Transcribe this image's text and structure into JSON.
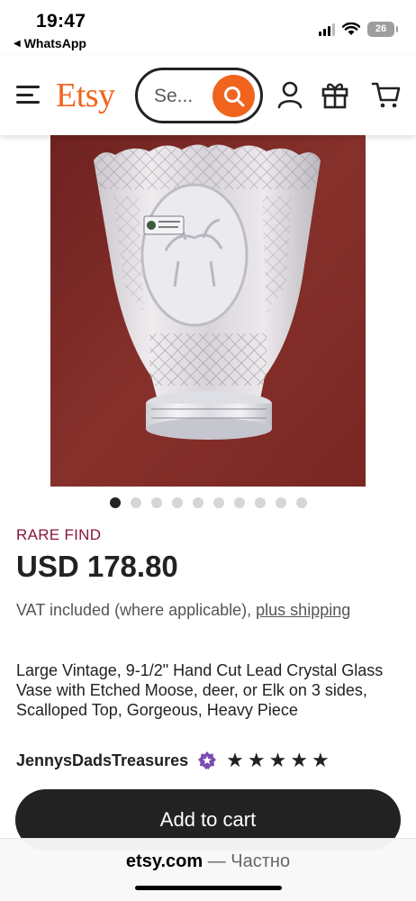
{
  "status_bar": {
    "time": "19:47",
    "back_app": "WhatsApp",
    "battery": "26"
  },
  "header": {
    "logo": "Etsy",
    "search_placeholder": "Se...",
    "icons": [
      "menu-icon",
      "search-icon",
      "account-icon",
      "gift-icon",
      "cart-icon"
    ],
    "accent_color": "#f1641e"
  },
  "gallery": {
    "image_count": 10,
    "active_index": 0,
    "background_color": "#7a2724"
  },
  "product": {
    "badge": "RARE FIND",
    "price": "USD 178.80",
    "vat_text": "VAT included (where applicable), ",
    "shipping_link": "plus shipping",
    "title": "Large Vintage, 9-1/2\" Hand Cut Lead Crystal Glass Vase with Etched Moose, deer, or Elk on 3 sides, Scalloped Top, Gorgeous, Heavy Piece",
    "seller": "JennysDadsTreasures",
    "rating_stars": 5,
    "add_to_cart": "Add to cart"
  },
  "browser": {
    "domain": "etsy.com",
    "separator": " — ",
    "privacy": "Частно"
  }
}
